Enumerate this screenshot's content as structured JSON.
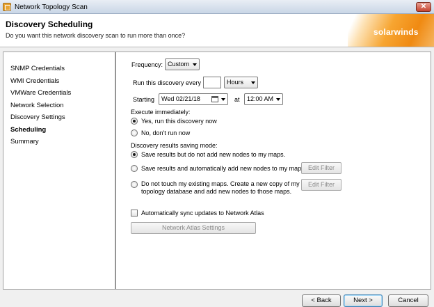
{
  "window": {
    "title": "Network Topology Scan",
    "close_glyph": "✕"
  },
  "header": {
    "title": "Discovery Scheduling",
    "subtitle": "Do you want this network discovery scan to run more than once?",
    "logo_text": "solarwinds"
  },
  "nav": {
    "items": [
      {
        "label": "SNMP Credentials"
      },
      {
        "label": "WMI Credentials"
      },
      {
        "label": "VMWare Credentials"
      },
      {
        "label": "Network Selection"
      },
      {
        "label": "Discovery Settings"
      },
      {
        "label": "Scheduling"
      },
      {
        "label": "Summary"
      }
    ]
  },
  "form": {
    "frequency_label": "Frequency:",
    "frequency_value": "Custom",
    "run_every_label": "Run this discovery every",
    "run_every_value": "",
    "run_every_unit": "Hours",
    "starting_label": "Starting",
    "starting_date": "Wed 02/21/18",
    "at_label": "at",
    "starting_time": "12:00 AM",
    "execute_label": "Execute immediately:",
    "execute_yes": "Yes, run this discovery now",
    "execute_no": "No, don't run now",
    "saving_mode_label": "Discovery results saving mode:",
    "save_option_1": "Save results but do not add new nodes to my maps.",
    "save_option_2": "Save results and automatically add new nodes to my maps.",
    "save_option_3_line1": "Do not touch my existing maps. Create a new copy of my",
    "save_option_3_line2": "topology database and add new nodes to those maps.",
    "edit_filter_label": "Edit Filter",
    "sync_label": "Automatically sync updates to Network Atlas",
    "atlas_settings_label": "Network Atlas Settings"
  },
  "footer": {
    "back_label": "< Back",
    "next_label": "Next >",
    "cancel_label": "Cancel"
  },
  "icons": {
    "app": "app-icon",
    "calendar": "calendar-icon"
  },
  "colors": {
    "accent": "#f08a12",
    "titlebar": "#c9d6e6"
  }
}
